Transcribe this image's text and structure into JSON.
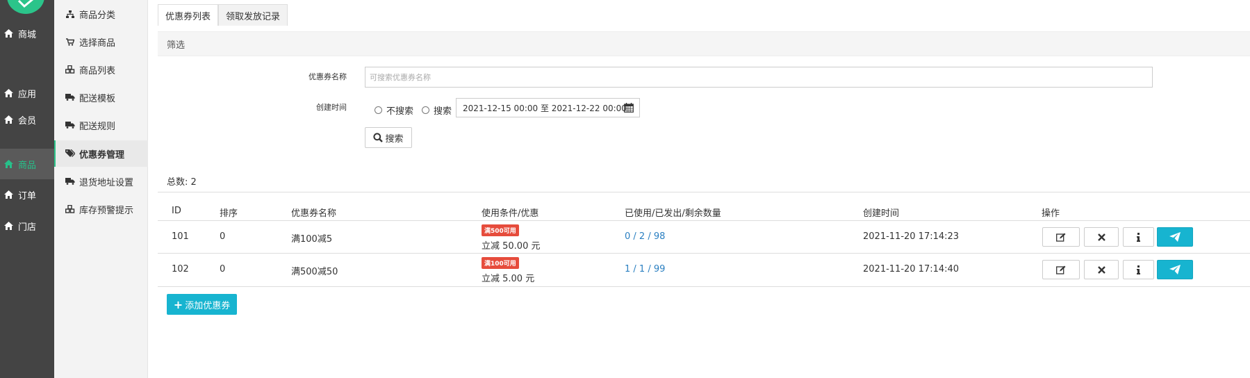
{
  "nav1": {
    "items": [
      {
        "label": "商城",
        "icon": "home-icon"
      },
      {
        "label": "应用",
        "icon": "home-icon"
      },
      {
        "label": "会员",
        "icon": "home-icon"
      },
      {
        "label": "商品",
        "icon": "home-icon",
        "active": true
      },
      {
        "label": "订单",
        "icon": "home-icon"
      },
      {
        "label": "门店",
        "icon": "home-icon"
      }
    ]
  },
  "nav2": {
    "items": [
      {
        "label": "商品分类",
        "icon": "sitemap-icon"
      },
      {
        "label": "选择商品",
        "icon": "cart-icon"
      },
      {
        "label": "商品列表",
        "icon": "cubes-icon"
      },
      {
        "label": "配送模板",
        "icon": "truck-icon"
      },
      {
        "label": "配送规则",
        "icon": "truck-icon"
      },
      {
        "label": "优惠券管理",
        "icon": "tags-icon",
        "active": true
      },
      {
        "label": "退货地址设置",
        "icon": "truck-icon"
      },
      {
        "label": "库存预警提示",
        "icon": "cubes-icon"
      }
    ]
  },
  "tabs": [
    {
      "label": "优惠券列表",
      "active": true
    },
    {
      "label": "领取发放记录",
      "active": false
    }
  ],
  "filter": {
    "title": "筛选",
    "name_label": "优惠券名称",
    "name_placeholder": "可搜索优惠券名称",
    "time_label": "创建时间",
    "radio_no_search": "不搜索",
    "radio_search": "搜索",
    "date_range": "2021-12-15 00:00 至 2021-12-22 00:00",
    "search_button": "搜索"
  },
  "total_text": "总数: 2",
  "table": {
    "headers": [
      "ID",
      "排序",
      "优惠券名称",
      "使用条件/优惠",
      "已使用/已发出/剩余数量",
      "创建时间",
      "操作"
    ],
    "rows": [
      {
        "id": "101",
        "sort": "0",
        "name": "满100减5",
        "badge": "满500可用",
        "discount": "立减 50.00 元",
        "counts": "0 / 2 / 98",
        "created": "2021-11-20 17:14:23"
      },
      {
        "id": "102",
        "sort": "0",
        "name": "满500减50",
        "badge": "满100可用",
        "discount": "立减 5.00 元",
        "counts": "1 / 1 / 99",
        "created": "2021-11-20 17:14:40"
      }
    ]
  },
  "add_button": "添加优惠券",
  "colors": {
    "accent": "#2bc48a",
    "info": "#17b4d0",
    "badge": "#e64c3c",
    "link": "#2a7fc1"
  }
}
